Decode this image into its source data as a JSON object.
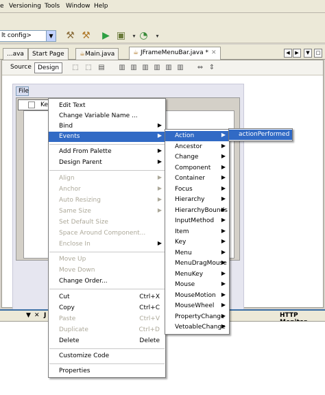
{
  "menubar": {
    "items": [
      "e",
      "Versioning",
      "Tools",
      "Window",
      "Help"
    ]
  },
  "toolbar": {
    "config_value": "lt config>",
    "icons": [
      "hammer-icon",
      "clean-build-icon",
      "run-icon",
      "debug-icon",
      "profile-icon"
    ]
  },
  "tabs": [
    {
      "label": "...ava"
    },
    {
      "label": "Start Page"
    },
    {
      "label": "Main.java"
    },
    {
      "label": "JFrameMenuBar.java *"
    }
  ],
  "editor": {
    "source_label": "Source",
    "design_label": "Design",
    "file_menu_label": "File",
    "kelu_item_label": "Kelu"
  },
  "context_menu": {
    "items": [
      {
        "label": "Edit Text"
      },
      {
        "label": "Change Variable Name ..."
      },
      {
        "label": "Bind"
      },
      {
        "label": "Events"
      },
      {
        "label": "Add From Palette"
      },
      {
        "label": "Design Parent"
      },
      {
        "label": "Align"
      },
      {
        "label": "Anchor"
      },
      {
        "label": "Auto Resizing"
      },
      {
        "label": "Same Size"
      },
      {
        "label": "Set Default Size"
      },
      {
        "label": "Space Around Component..."
      },
      {
        "label": "Enclose In"
      },
      {
        "label": "Move Up"
      },
      {
        "label": "Move Down"
      },
      {
        "label": "Change Order..."
      },
      {
        "label": "Cut",
        "shortcut": "Ctrl+X"
      },
      {
        "label": "Copy",
        "shortcut": "Ctrl+C"
      },
      {
        "label": "Paste",
        "shortcut": "Ctrl+V"
      },
      {
        "label": "Duplicate",
        "shortcut": "Ctrl+D"
      },
      {
        "label": "Delete",
        "shortcut": "Delete"
      },
      {
        "label": "Customize Code"
      },
      {
        "label": "Properties"
      }
    ]
  },
  "events_menu": {
    "items": [
      "Action",
      "Ancestor",
      "Change",
      "Component",
      "Container",
      "Focus",
      "Hierarchy",
      "HierarchyBounds",
      "InputMethod",
      "Item",
      "Key",
      "Menu",
      "MenuDragMouse",
      "MenuKey",
      "Mouse",
      "MouseMotion",
      "MouseWheel",
      "PropertyChange",
      "VetoableChange"
    ]
  },
  "action_menu": {
    "items": [
      "actionPerformed"
    ]
  },
  "bottom": {
    "left_label": "J",
    "right_label": "HTTP Monitor"
  },
  "colors": {
    "highlight": "#316ac5",
    "disabled": "#aca899"
  }
}
